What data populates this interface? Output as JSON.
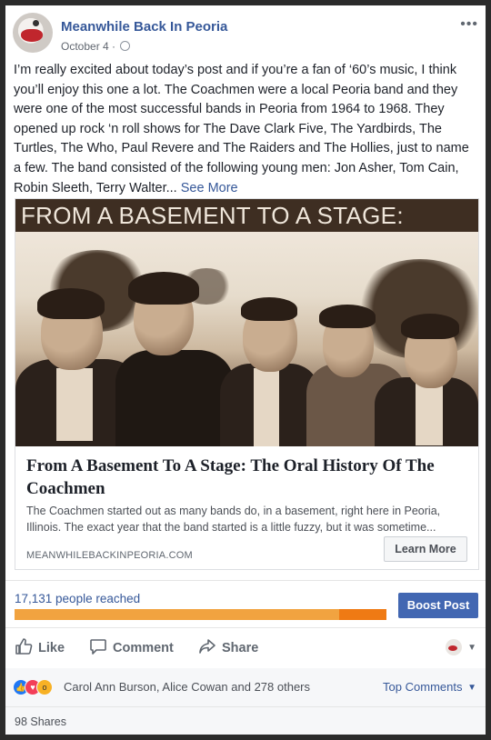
{
  "post": {
    "page_name": "Meanwhile Back In Peoria",
    "date": "October 4",
    "separator": "·",
    "body_text": "I’m really excited about today’s post and if you’re a fan of ‘60’s music, I think you’ll enjoy this one a lot. The Coachmen were a local Peoria band and they were one of the most successful bands in Peoria from 1964 to 1968. They opened up rock ‘n roll shows for The Dave Clark Five, The Yardbirds, The Turtles, The Who, Paul Revere and The Raiders and The Hollies, just to name a few. The band consisted of the following young men: Jon Asher, Tom Cain, Robin Sleeth, Terry Walter...",
    "see_more": "See More",
    "more_icon": "•••"
  },
  "link": {
    "banner_text": "FROM A BASEMENT TO A STAGE:",
    "title": "From A Basement To A Stage: The Oral History Of The Coachmen",
    "description": "The Coachmen started out as many bands do, in a basement, right here in Peoria, Illinois. The exact year that the band started is a little fuzzy, but it was sometime...",
    "domain": "MEANWHILEBACKINPEORIA.COM",
    "cta": "Learn More"
  },
  "insights": {
    "reached": "17,131 people reached",
    "boost_label": "Boost Post"
  },
  "actions": {
    "like": "Like",
    "comment": "Comment",
    "share": "Share"
  },
  "reactions": {
    "names": "Carol Ann Burson, Alice Cowan and 278 others",
    "top_comments": "Top Comments",
    "icons": [
      "like-icon",
      "love-icon",
      "wow-icon"
    ]
  },
  "shares": "98 Shares",
  "colors": {
    "link_blue": "#365899",
    "boost_blue": "#4267b2",
    "reach_orange": "#ef7a14"
  }
}
